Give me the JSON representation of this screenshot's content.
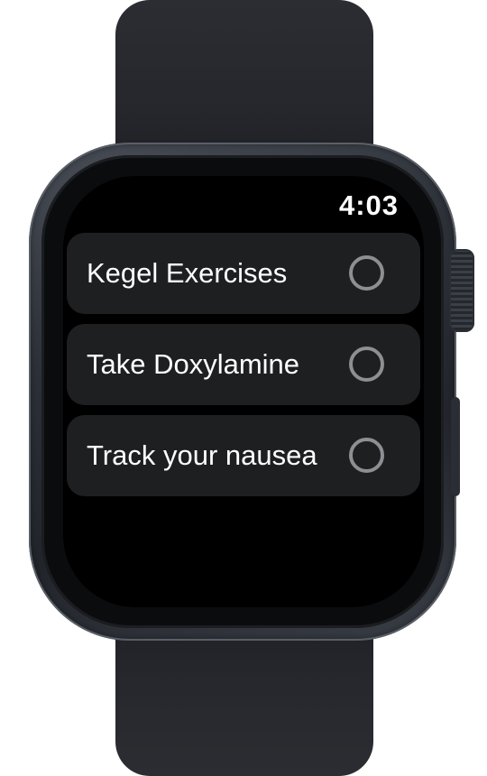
{
  "status_bar": {
    "time": "4:03"
  },
  "reminders": [
    {
      "label": "Kegel Exercises",
      "checked": false
    },
    {
      "label": "Take Doxylamine",
      "checked": false
    },
    {
      "label": "Track your nausea",
      "checked": false
    }
  ],
  "colors": {
    "screen_background": "#000000",
    "row_background": "#1e1f21",
    "text": "#ffffff",
    "checkbox_ring": "#8e8e93",
    "watch_case": "#2d3138",
    "watch_band": "#26282d"
  },
  "icons": {
    "checkbox": "empty-circle-icon",
    "crown": "digital-crown"
  }
}
